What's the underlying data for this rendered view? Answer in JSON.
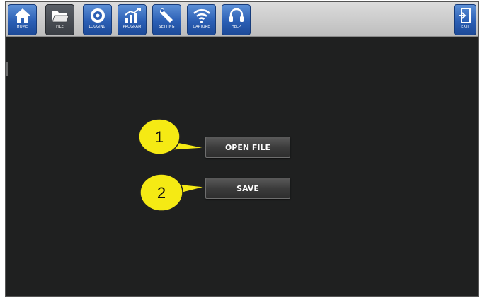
{
  "toolbar": {
    "buttons": [
      {
        "label": "HOME",
        "icon": "home-icon"
      },
      {
        "label": "FILE",
        "icon": "folder-icon",
        "active": true
      },
      {
        "label": "LOGGING",
        "icon": "disc-icon"
      },
      {
        "label": "PROGRAM",
        "icon": "chart-icon"
      },
      {
        "label": "SETTING",
        "icon": "wrench-icon"
      },
      {
        "label": "CAPTURE",
        "icon": "wifi-icon"
      },
      {
        "label": "HELP",
        "icon": "headset-icon"
      }
    ],
    "exit": {
      "label": "EXIT",
      "icon": "exit-icon"
    }
  },
  "main": {
    "open_file_label": "OPEN FILE",
    "save_label": "SAVE"
  },
  "callouts": [
    {
      "number": "1"
    },
    {
      "number": "2"
    }
  ],
  "colors": {
    "toolbar_button": "#2b5fb5",
    "screen_background": "#1f2020",
    "callout_fill": "#f5ea14"
  }
}
